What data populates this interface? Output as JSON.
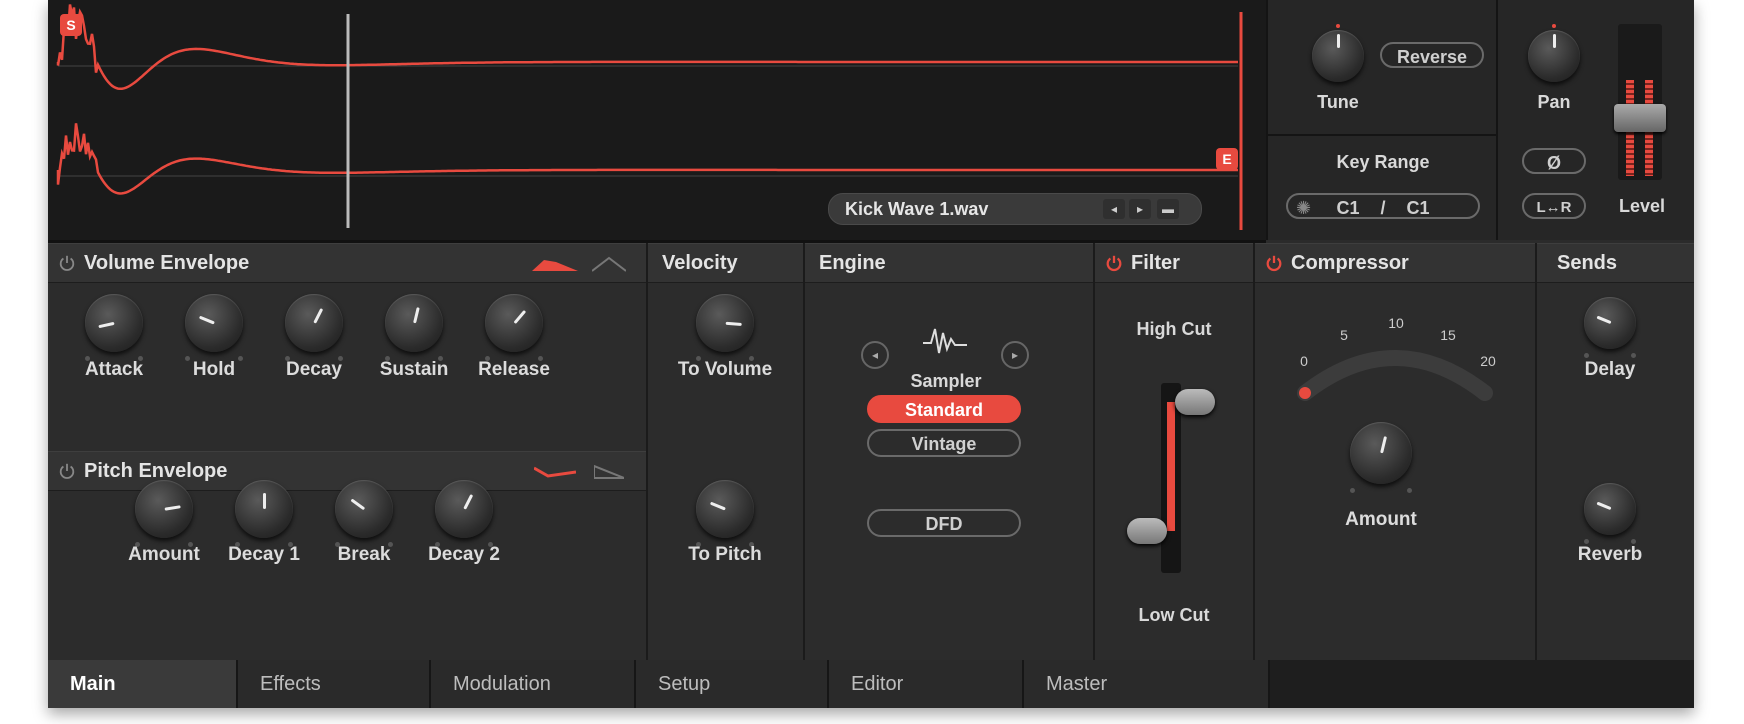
{
  "colors": {
    "accent": "#e84a3f",
    "panel": "#2c2c2c",
    "text": "#dcdcdc"
  },
  "sample": {
    "filename": "Kick Wave 1.wav",
    "start_marker": "S",
    "end_marker": "E",
    "prev_icon": "chevron-left-icon",
    "next_icon": "chevron-right-icon",
    "folder_icon": "folder-icon"
  },
  "top": {
    "tune": "Tune",
    "reverse": "Reverse",
    "key_range": "Key Range",
    "key_low": "C1",
    "key_sep": "/",
    "key_high": "C1",
    "pan": "Pan",
    "phase": "Ø",
    "lr": "L↔R",
    "level": "Level"
  },
  "volume_envelope": {
    "title": "Volume Envelope",
    "knobs": [
      {
        "label": "Attack",
        "value": 0.12
      },
      {
        "label": "Hold",
        "value": 0.25
      },
      {
        "label": "Decay",
        "value": 0.6
      },
      {
        "label": "Sustain",
        "value": 0.55
      },
      {
        "label": "Release",
        "value": 0.65
      }
    ]
  },
  "pitch_envelope": {
    "title": "Pitch Envelope",
    "knobs": [
      {
        "label": "Amount",
        "value": 0.8
      },
      {
        "label": "Decay 1",
        "value": 0.5
      },
      {
        "label": "Break",
        "value": 0.3
      },
      {
        "label": "Decay 2",
        "value": 0.6
      }
    ]
  },
  "velocity": {
    "title": "Velocity",
    "to_volume": "To Volume",
    "to_volume_value": 0.85,
    "to_pitch": "To Pitch",
    "to_pitch_value": 0.25
  },
  "engine": {
    "title": "Engine",
    "mode": "Sampler",
    "options": [
      "Standard",
      "Vintage",
      "DFD"
    ],
    "selected": "Standard"
  },
  "filter": {
    "title": "Filter",
    "high_cut": "High Cut",
    "low_cut": "Low Cut",
    "high_value": 0.9,
    "low_value": 0.22
  },
  "compressor": {
    "title": "Compressor",
    "scale": [
      "0",
      "5",
      "10",
      "15",
      "20"
    ],
    "amount_label": "Amount",
    "amount_value": 0.55
  },
  "sends": {
    "title": "Sends",
    "delay": "Delay",
    "delay_value": 0.25,
    "reverb": "Reverb",
    "reverb_value": 0.25
  },
  "tabs": [
    {
      "label": "Main",
      "active": true
    },
    {
      "label": "Effects"
    },
    {
      "label": "Modulation"
    },
    {
      "label": "Setup"
    },
    {
      "label": "Editor"
    },
    {
      "label": "Master"
    }
  ]
}
